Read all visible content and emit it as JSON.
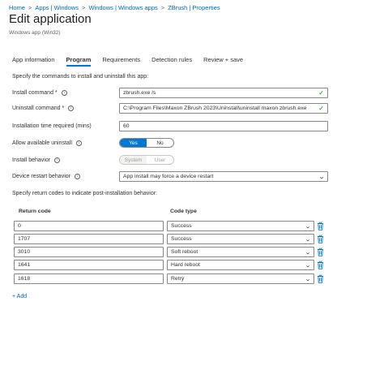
{
  "breadcrumb": [
    "Home",
    "Apps | Windows",
    "Windows | Windows apps",
    "ZBrush | Properties"
  ],
  "page": {
    "title": "Edit application",
    "subtitle": "Windows app (Win32)"
  },
  "tabs": [
    "App information",
    "Program",
    "Requirements",
    "Detection rules",
    "Review + save"
  ],
  "active_tab": "Program",
  "intro": "Specify the commands to install and uninstall this app:",
  "fields": {
    "install_command": {
      "label": "Install command *",
      "value": "zbrush.exe /s"
    },
    "uninstall_command": {
      "label": "Uninstall command *",
      "value": "C:\\Program Files\\Maxon ZBrush 2023\\Uninstall\\uninstall maxon zbrush.exe"
    },
    "install_time": {
      "label": "Installation time required (mins)",
      "value": "60"
    },
    "allow_uninstall": {
      "label": "Allow available uninstall",
      "options": [
        "Yes",
        "No"
      ],
      "selected": "Yes"
    },
    "install_behavior": {
      "label": "Install behavior",
      "options": [
        "System",
        "User"
      ],
      "selected": "System"
    },
    "restart_behavior": {
      "label": "Device restart behavior",
      "value": "App install may force a device restart"
    }
  },
  "return_codes": {
    "intro": "Specify return codes to indicate post-installation behavior:",
    "col_code": "Return code",
    "col_type": "Code type",
    "rows": [
      {
        "code": "0",
        "type": "Success"
      },
      {
        "code": "1707",
        "type": "Success"
      },
      {
        "code": "3010",
        "type": "Soft reboot"
      },
      {
        "code": "1641",
        "type": "Hard reboot"
      },
      {
        "code": "1618",
        "type": "Retry"
      }
    ],
    "add_label": "+ Add"
  },
  "icons": {
    "info": "info-icon",
    "check": "checkmark-icon",
    "chevron": "chevron-down-icon",
    "delete": "trash-icon"
  },
  "colors": {
    "accent": "#0078d4",
    "link": "#0067b8",
    "valid": "#107c10"
  }
}
